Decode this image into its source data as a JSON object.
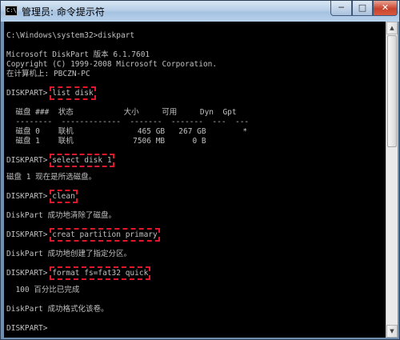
{
  "window": {
    "title": "管理员: 命令提示符",
    "icon_text": "C:\\"
  },
  "controls": {
    "minimize": "─",
    "maximize": "□",
    "close": "✕"
  },
  "console": {
    "lines": {
      "l1": "C:\\Windows\\system32>diskpart",
      "l2": "Microsoft DiskPart 版本 6.1.7601",
      "l3": "Copyright (C) 1999-2008 Microsoft Corporation.",
      "l4": "在计算机上: PBCZN-PC",
      "l5_prompt": "DISKPART> ",
      "l5_cmd": "list disk",
      "l6": "  磁盘 ###  状态           大小     可用     Dyn  Gpt",
      "l7": "  --------  -------------  -------  -------  ---  ---",
      "l8": "  磁盘 0    联机              465 GB   267 GB        *",
      "l9": "  磁盘 1    联机             7506 MB      0 B",
      "l10_prompt": "DISKPART> ",
      "l10_cmd": "select disk 1",
      "l11": "磁盘 1 现在是所选磁盘。",
      "l12_prompt": "DISKPART> ",
      "l12_cmd": "clean",
      "l13": "DiskPart 成功地清除了磁盘。",
      "l14_prompt": "DISKPART> ",
      "l14_cmd": "creat partition primary",
      "l15": "DiskPart 成功地创建了指定分区。",
      "l16_prompt": "DISKPART> ",
      "l16_cmd": "format fs=fat32 quick",
      "l17": "  100 百分比已完成",
      "l18": "DiskPart 成功格式化该卷。",
      "l19": "DISKPART> "
    }
  },
  "scrollbar": {
    "up": "▲",
    "down": "▼"
  },
  "colors": {
    "console_bg": "#000000",
    "console_text": "#c0c0c0",
    "highlight": "#e0182b"
  }
}
